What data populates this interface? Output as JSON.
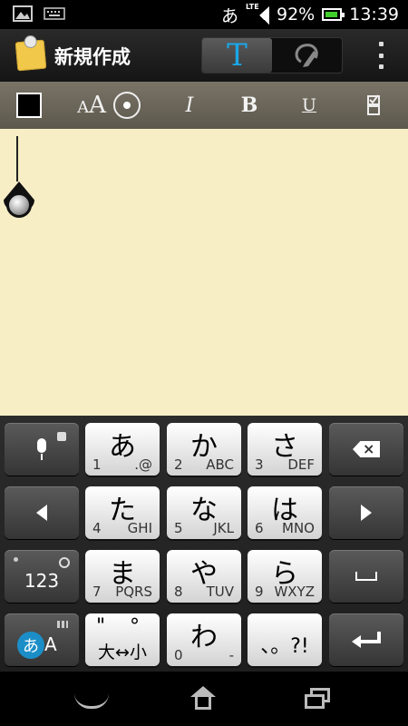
{
  "status_bar": {
    "ime_indicator": "あ",
    "network": "LTE",
    "battery_percent": "92%",
    "time": "13:39",
    "battery_level": 0.92,
    "icons": [
      "image-icon",
      "keyboard-icon",
      "signal-icon",
      "battery-icon"
    ]
  },
  "action_bar": {
    "title": "新規作成",
    "text_mode_label": "T",
    "icons": [
      "app-icon",
      "handwriting-icon",
      "overflow-menu-icon"
    ]
  },
  "format_bar": {
    "color_swatch": "#000000",
    "size_small": "A",
    "size_large": "A",
    "italic": "I",
    "bold": "B",
    "underline": "U",
    "icons": [
      "color-swatch",
      "font-size-icon",
      "checklist-icon"
    ]
  },
  "note": {
    "background": "#f8eec6",
    "content": ""
  },
  "keyboard": {
    "rows": [
      [
        {
          "type": "mic",
          "name": "voice-input-key"
        },
        {
          "kana": "あ",
          "num": "1",
          "alpha": ".@"
        },
        {
          "kana": "か",
          "num": "2",
          "alpha": "ABC"
        },
        {
          "kana": "さ",
          "num": "3",
          "alpha": "DEF"
        },
        {
          "type": "backspace",
          "name": "backspace-key"
        }
      ],
      [
        {
          "type": "left",
          "name": "cursor-left-key"
        },
        {
          "kana": "た",
          "num": "4",
          "alpha": "GHI"
        },
        {
          "kana": "な",
          "num": "5",
          "alpha": "JKL"
        },
        {
          "kana": "は",
          "num": "6",
          "alpha": "MNO"
        },
        {
          "type": "right",
          "name": "cursor-right-key"
        }
      ],
      [
        {
          "type": "num",
          "label": "123",
          "name": "numbers-key"
        },
        {
          "kana": "ま",
          "num": "7",
          "alpha": "PQRS"
        },
        {
          "kana": "や",
          "num": "8",
          "alpha": "TUV"
        },
        {
          "kana": "ら",
          "num": "9",
          "alpha": "WXYZ"
        },
        {
          "type": "space",
          "name": "space-key"
        }
      ],
      [
        {
          "type": "ime",
          "label_kana": "あ",
          "label_alpha": "A",
          "name": "input-mode-key"
        },
        {
          "type": "daku",
          "top": "\" °",
          "bottom": "大↔小",
          "name": "dakuten-key"
        },
        {
          "kana": "わ",
          "num": "0",
          "alpha": "-"
        },
        {
          "type": "punct",
          "label": "、。?!",
          "name": "punctuation-key"
        },
        {
          "type": "enter",
          "name": "enter-key"
        }
      ]
    ]
  },
  "nav_bar": {
    "icons": [
      "back-icon",
      "home-icon",
      "recent-apps-icon"
    ]
  }
}
